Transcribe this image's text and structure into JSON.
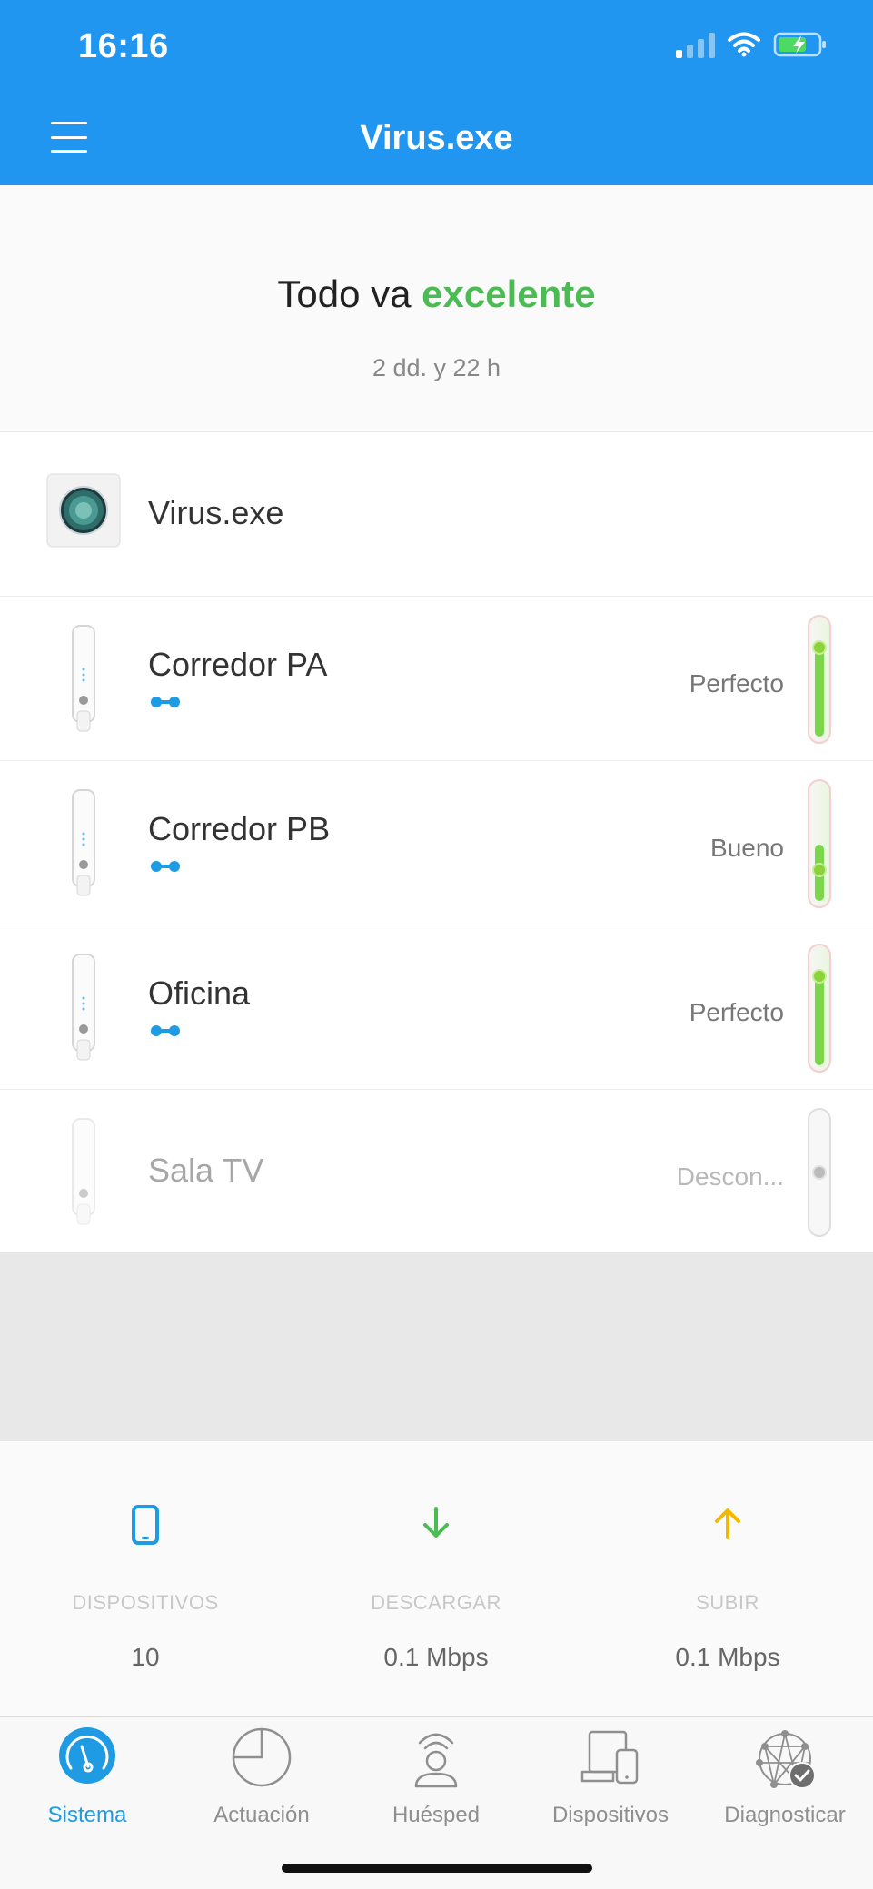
{
  "status_bar": {
    "time": "16:16"
  },
  "header": {
    "title": "Virus.exe"
  },
  "summary": {
    "status_prefix": "Todo va",
    "status_word": "excelente",
    "uptime": "2 dd. y 22 h"
  },
  "devices": [
    {
      "name": "Virus.exe",
      "type": "router"
    },
    {
      "name": "Corredor PA",
      "type": "node",
      "quality": "Perfecto",
      "signal_level": 0.8
    },
    {
      "name": "Corredor PB",
      "type": "node",
      "quality": "Bueno",
      "signal_level": 0.4
    },
    {
      "name": "Oficina",
      "type": "node",
      "quality": "Perfecto",
      "signal_level": 0.8
    },
    {
      "name": "Sala TV",
      "type": "node",
      "quality": "Descon...",
      "signal_level": 0.5,
      "offline": true
    }
  ],
  "stats": [
    {
      "label": "DISPOSITIVOS",
      "value": "10",
      "icon": "phone-icon",
      "color": "#1e9be2"
    },
    {
      "label": "DESCARGAR",
      "value": "0.1 Mbps",
      "icon": "arrow-down-icon",
      "color": "#4cbb54"
    },
    {
      "label": "SUBIR",
      "value": "0.1 Mbps",
      "icon": "arrow-up-icon",
      "color": "#f5b800"
    }
  ],
  "tabs": [
    {
      "label": "Sistema",
      "icon": "gauge-icon",
      "active": true
    },
    {
      "label": "Actuación",
      "icon": "pie-chart-icon"
    },
    {
      "label": "Huésped",
      "icon": "guest-icon"
    },
    {
      "label": "Dispositivos",
      "icon": "devices-icon"
    },
    {
      "label": "Diagnosticar",
      "icon": "network-check-icon"
    }
  ],
  "colors": {
    "header": "#2196f0",
    "good": "#4cbb54",
    "accent": "#1e9be2"
  }
}
